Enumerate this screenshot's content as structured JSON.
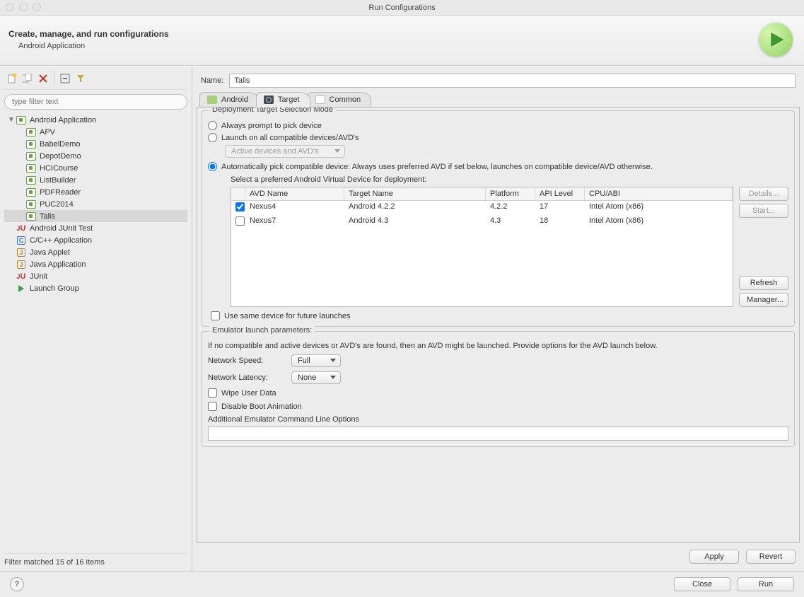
{
  "window": {
    "title": "Run Configurations"
  },
  "header": {
    "title": "Create, manage, and run configurations",
    "subtitle": "Android Application"
  },
  "sidebar": {
    "filter_placeholder": "type filter text",
    "root_label": "Android Application",
    "configs": [
      "APV",
      "BabelDemo",
      "DepotDemo",
      "HCICourse",
      "ListBuilder",
      "PDFReader",
      "PUC2014",
      "Talis"
    ],
    "others": [
      {
        "label": "Android JUnit Test",
        "icon": "ju"
      },
      {
        "label": "C/C++ Application",
        "icon": "c"
      },
      {
        "label": "Java Applet",
        "icon": "j"
      },
      {
        "label": "Java Application",
        "icon": "j"
      },
      {
        "label": "JUnit",
        "icon": "ju"
      },
      {
        "label": "Launch Group",
        "icon": "tri"
      }
    ],
    "filter_status": "Filter matched 15 of 16 items"
  },
  "form": {
    "name_label": "Name:",
    "name_value": "Talis",
    "tabs": {
      "android": "Android",
      "target": "Target",
      "common": "Common"
    },
    "deploy": {
      "legend": "Deployment Target Selection Mode",
      "opt_prompt": "Always prompt to pick device",
      "opt_all": "Launch on all compatible devices/AVD's",
      "all_sub": "Active devices and AVD's",
      "opt_auto": "Automatically pick compatible device: Always uses preferred AVD if set below, launches on compatible device/AVD otherwise.",
      "avd_caption": "Select a preferred Android Virtual Device for deployment:",
      "headers": [
        "AVD Name",
        "Target Name",
        "Platform",
        "API Level",
        "CPU/ABI"
      ],
      "rows": [
        {
          "checked": true,
          "name": "Nexus4",
          "target": "Android 4.2.2",
          "platform": "4.2.2",
          "api": "17",
          "cpu": "Intel Atom (x86)"
        },
        {
          "checked": false,
          "name": "Nexus7",
          "target": "Android 4.3",
          "platform": "4.3",
          "api": "18",
          "cpu": "Intel Atom (x86)"
        }
      ],
      "btn_details": "Details...",
      "btn_start": "Start...",
      "btn_refresh": "Refresh",
      "btn_manager": "Manager...",
      "use_same": "Use same device for future launches"
    },
    "emulator": {
      "legend": "Emulator launch parameters:",
      "note": "If no compatible and active devices or AVD's are found, then an AVD might be launched. Provide options for the AVD launch below.",
      "net_speed_label": "Network Speed:",
      "net_speed": "Full",
      "net_latency_label": "Network Latency:",
      "net_latency": "None",
      "wipe": "Wipe User Data",
      "boot": "Disable Boot Animation",
      "extra": "Additional Emulator Command Line Options"
    },
    "apply": "Apply",
    "revert": "Revert"
  },
  "footer": {
    "close": "Close",
    "run": "Run"
  }
}
